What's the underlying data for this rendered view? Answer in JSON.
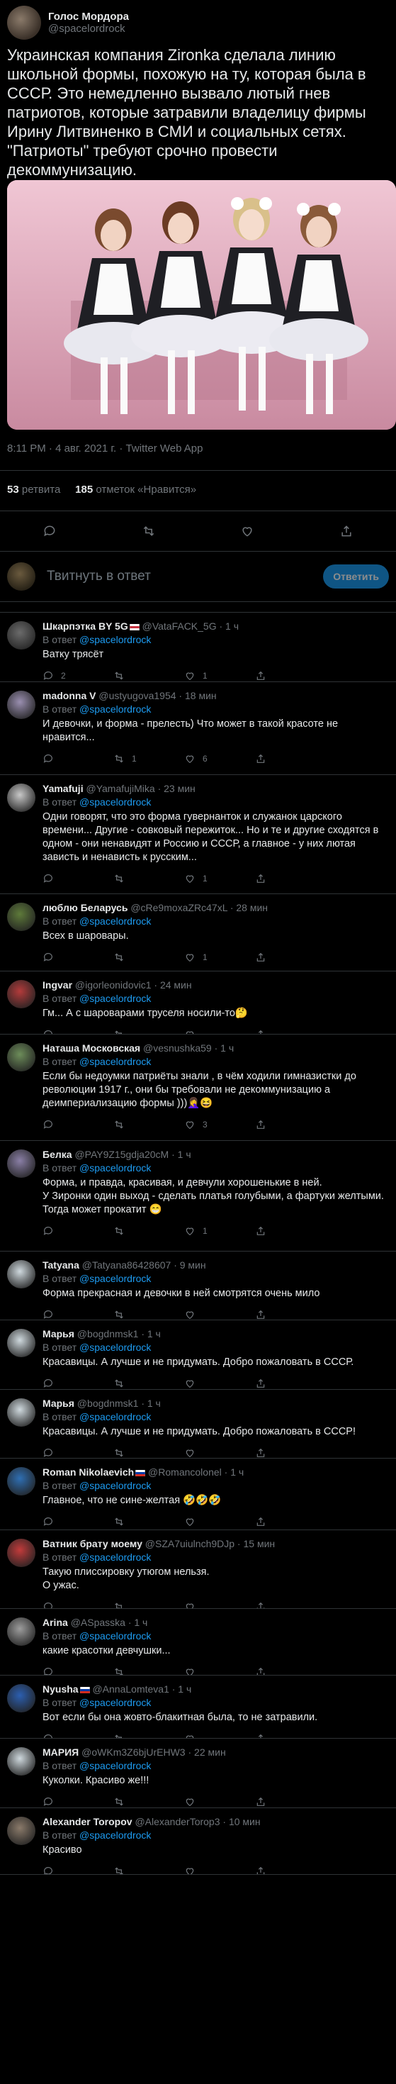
{
  "tweet": {
    "author_name": "Голос Мордора",
    "author_handle": "@spacelordrock",
    "text": "Украинская компания Zironka сделала линию школьной формы, похожую на ту, которая была в СССР. Это немедленно вызвало лютый гнев патриотов, которые затравили владелицу фирмы Ирину Литвиненко в СМИ и социальных сетях. \"Патриоты\" требуют срочно провести декоммунизацию.",
    "timestamp": "8:11 PM · 4 авг. 2021 г. · Twitter Web App",
    "retweets_count": "53",
    "retweets_label": "ретвита",
    "likes_count": "185",
    "likes_label": "отметок «Нравится»"
  },
  "compose": {
    "placeholder": "Твитнуть в ответ",
    "button_label": "Ответить"
  },
  "replies": [
    {
      "name": "Шкарпэтка BY 5G",
      "flag": "by",
      "handle": "@VataFACK_5G · 1 ч",
      "to_prefix": "В ответ",
      "to": "@spacelordrock",
      "text": "Ватку трясёт",
      "reply_count": "2",
      "retweet_count": "",
      "like_count": "1",
      "avatar": "#6b6b6b"
    },
    {
      "name": "madonna V",
      "flag": "",
      "handle": "@ustyugova1954 · 18 мин",
      "to_prefix": "В ответ",
      "to": "@spacelordrock",
      "text": "И девочки, и форма - прелесть) Что может в такой красоте не нравится...",
      "reply_count": "",
      "retweet_count": "1",
      "like_count": "6",
      "avatar": "#9a8fb0"
    },
    {
      "name": "Yamafuji",
      "flag": "",
      "handle": "@YamafujiMika · 23 мин",
      "to_prefix": "В ответ",
      "to": "@spacelordrock",
      "text": "Одни говорят, что это форма гувернанток и служанок царского времени... Другие - совковый пережиток... Но и те и другие сходятся в одном - они ненавидят и Россию и СССР, а главное - у них лютая зависть и ненависть к русским...",
      "reply_count": "",
      "retweet_count": "",
      "like_count": "1",
      "avatar": "#c8c8c8"
    },
    {
      "name": "люблю Беларусь",
      "flag": "",
      "handle": "@cRe9moxaZRc47xL · 28 мин",
      "to_prefix": "В ответ",
      "to": "@spacelordrock",
      "text": "Всех в шаровары.",
      "reply_count": "",
      "retweet_count": "",
      "like_count": "1",
      "avatar": "#5e7a3a"
    },
    {
      "name": "Ingvar",
      "flag": "",
      "handle": "@igorleonidovic1 · 24 мин",
      "to_prefix": "В ответ",
      "to": "@spacelordrock",
      "text": "Гм... А с шароварами труселя носили-то🤔",
      "reply_count": "",
      "retweet_count": "",
      "like_count": "",
      "avatar": "#b33b3b"
    },
    {
      "name": "Наташа Московская",
      "flag": "",
      "handle": "@vesnushka59 · 1 ч",
      "to_prefix": "В ответ",
      "to": "@spacelordrock",
      "text": "Если бы недоумки патриёты знали , в чём ходили гимназистки до революции 1917 г., они бы требовали  не декоммунизацию  а деимпериализацию формы )))🤦‍♀️😆",
      "reply_count": "",
      "retweet_count": "",
      "like_count": "3",
      "avatar": "#6d8d5a"
    },
    {
      "name": "Белка",
      "flag": "",
      "handle": "@PAY9Z15gdja20cM · 1 ч",
      "to_prefix": "В ответ",
      "to": "@spacelordrock",
      "text": "Форма, и правда, красивая, и девчули хорошенькие в ней.\nУ Зиронки один выход - сделать платья голубыми, а фартуки желтыми. Тогда может прокатит 😁",
      "reply_count": "",
      "retweet_count": "",
      "like_count": "1",
      "avatar": "#8a7fa6"
    },
    {
      "name": "Tatyana",
      "flag": "",
      "handle": "@Tatyana86428607 · 9 мин",
      "to_prefix": "В ответ",
      "to": "@spacelordrock",
      "text": "Форма прекрасная и девочки в ней смотрятся очень мило",
      "reply_count": "",
      "retweet_count": "",
      "like_count": "",
      "avatar": "#cfd9de"
    },
    {
      "name": "Марья",
      "flag": "",
      "handle": "@bogdnmsk1 · 1 ч",
      "to_prefix": "В ответ",
      "to": "@spacelordrock",
      "text": "Красавицы. А лучше и не придумать. Добро пожаловать в СССР.",
      "reply_count": "",
      "retweet_count": "",
      "like_count": "",
      "avatar": "#cfd9de"
    },
    {
      "name": "Марья",
      "flag": "",
      "handle": "@bogdnmsk1 · 1 ч",
      "to_prefix": "В ответ",
      "to": "@spacelordrock",
      "text": "Красавицы. А лучше и не придумать. Добро пожаловать в СССР!",
      "reply_count": "",
      "retweet_count": "",
      "like_count": "",
      "avatar": "#cfd9de"
    },
    {
      "name": "Roman Nikolaevich",
      "flag": "ru",
      "handle": "@Romancolonel · 1 ч",
      "to_prefix": "В ответ",
      "to": "@spacelordrock",
      "text": "Главное, что не сине-желтая 🤣🤣🤣",
      "reply_count": "",
      "retweet_count": "",
      "like_count": "",
      "avatar": "#2f6fb3"
    },
    {
      "name": "Ватник брату моему",
      "flag": "",
      "handle": "@SZA7uiulnch9DJp · 15 мин",
      "to_prefix": "В ответ",
      "to": "@spacelordrock",
      "text": "Такую плиссировку утюгом нельзя.\nО ужас.",
      "reply_count": "",
      "retweet_count": "",
      "like_count": "",
      "avatar": "#c23b3b"
    },
    {
      "name": "Arina",
      "flag": "",
      "handle": "@ASpasska · 1 ч",
      "to_prefix": "В ответ",
      "to": "@spacelordrock",
      "text": "какие красотки девчушки...",
      "reply_count": "",
      "retweet_count": "",
      "like_count": "",
      "avatar": "#9d9d9d"
    },
    {
      "name": "Nyusha",
      "flag": "ru",
      "handle": "@AnnaLomteva1 · 1 ч",
      "to_prefix": "В ответ",
      "to": "@spacelordrock",
      "text": "Вот если бы она жовто-блакитная была, то не затравили.",
      "reply_count": "",
      "retweet_count": "",
      "like_count": "",
      "avatar": "#2c5fb0"
    },
    {
      "name": "МАРИЯ",
      "flag": "",
      "handle": "@oWKm3Z6bjUrEHW3 · 22 мин",
      "to_prefix": "В ответ",
      "to": "@spacelordrock",
      "text": "Куколки. Красиво же!!!",
      "reply_count": "",
      "retweet_count": "",
      "like_count": "",
      "avatar": "#cfd9de"
    },
    {
      "name": "Alexander Toropov",
      "flag": "",
      "handle": "@AlexanderTorop3 · 10 мин",
      "to_prefix": "В ответ",
      "to": "@spacelordrock",
      "text": "Красиво",
      "reply_count": "",
      "retweet_count": "",
      "like_count": "",
      "avatar": "#8a7a6a"
    }
  ]
}
